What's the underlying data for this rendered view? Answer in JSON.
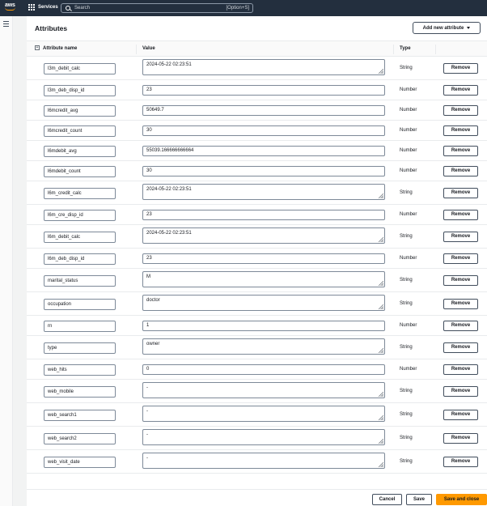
{
  "nav": {
    "logo": "aws",
    "services_label": "Services",
    "search_placeholder": "Search",
    "search_shortcut": "[Option+S]"
  },
  "panel": {
    "title": "Attributes",
    "add_button": "Add new attribute",
    "columns": [
      "Attribute name",
      "Value",
      "Type"
    ]
  },
  "rows": [
    {
      "name": "l3m_debit_calc",
      "value": "2024-05-22 02:23:51",
      "type": "String",
      "multiline": true
    },
    {
      "name": "l3m_deb_disp_id",
      "value": "23",
      "type": "Number",
      "multiline": false
    },
    {
      "name": "l6mcredit_avg",
      "value": "50649.7",
      "type": "Number",
      "multiline": false
    },
    {
      "name": "l6mcredit_count",
      "value": "30",
      "type": "Number",
      "multiline": false
    },
    {
      "name": "l6mdebit_avg",
      "value": "55039.166666666664",
      "type": "Number",
      "multiline": false
    },
    {
      "name": "l6mdebit_count",
      "value": "30",
      "type": "Number",
      "multiline": false
    },
    {
      "name": "l6m_credit_calc",
      "value": "2024-05-22 02:23:51",
      "type": "String",
      "multiline": true
    },
    {
      "name": "l6m_cre_disp_id",
      "value": "23",
      "type": "Number",
      "multiline": false
    },
    {
      "name": "l6m_debit_calc",
      "value": "2024-05-22 02:23:51",
      "type": "String",
      "multiline": true
    },
    {
      "name": "l6m_deb_disp_id",
      "value": "23",
      "type": "Number",
      "multiline": false
    },
    {
      "name": "marital_status",
      "value": "M",
      "type": "String",
      "multiline": true
    },
    {
      "name": "occupation",
      "value": "doctor",
      "type": "String",
      "multiline": true
    },
    {
      "name": "rn",
      "value": "1",
      "type": "Number",
      "multiline": false
    },
    {
      "name": "type",
      "value": "owner",
      "type": "String",
      "multiline": true
    },
    {
      "name": "web_hits",
      "value": "0",
      "type": "Number",
      "multiline": false
    },
    {
      "name": "web_mobile",
      "value": "-",
      "type": "String",
      "multiline": true
    },
    {
      "name": "web_search1",
      "value": "-",
      "type": "String",
      "multiline": true
    },
    {
      "name": "web_search2",
      "value": "-",
      "type": "String",
      "multiline": true
    },
    {
      "name": "web_visit_date",
      "value": "-",
      "type": "String",
      "multiline": true
    }
  ],
  "remove_label": "Remove",
  "footer": {
    "cancel": "Cancel",
    "save": "Save",
    "save_close": "Save and close"
  },
  "colors": {
    "nav_bg": "#232f3e",
    "primary": "#ff9900"
  }
}
